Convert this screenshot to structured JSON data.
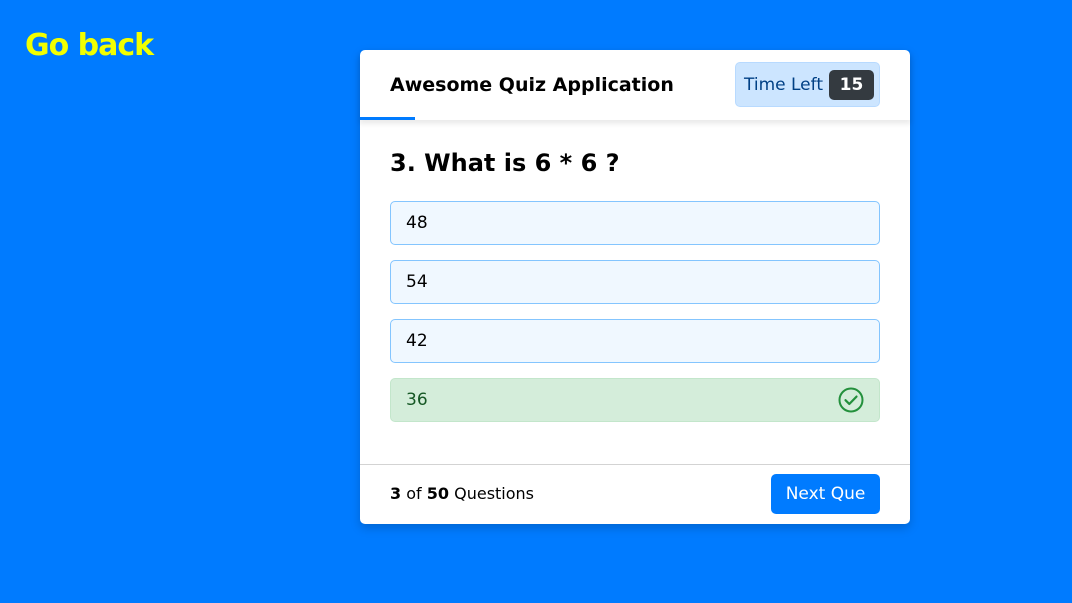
{
  "nav": {
    "go_back": "Go back"
  },
  "quiz": {
    "title": "Awesome Quiz Application",
    "timer": {
      "label": "Time Left",
      "seconds": "15"
    },
    "question": {
      "number": "3",
      "text": "3. What is 6 * 6 ?"
    },
    "options": [
      {
        "label": "48",
        "state": "default"
      },
      {
        "label": "54",
        "state": "default"
      },
      {
        "label": "42",
        "state": "default"
      },
      {
        "label": "36",
        "state": "correct",
        "icon": "check-circle-icon"
      }
    ],
    "footer": {
      "current": "3",
      "of": "of",
      "total": "50",
      "suffix": "Questions",
      "next_label": "Next Que"
    }
  },
  "colors": {
    "background": "#007bff",
    "go_back": "#f2ff00",
    "correct_bg": "#d4edda",
    "correct_text": "#155724",
    "option_bg": "#f0f8ff",
    "option_border": "#84c5fe",
    "timer_bg": "#cce5ff",
    "timer_sec_bg": "#343a40",
    "button": "#007bff"
  }
}
